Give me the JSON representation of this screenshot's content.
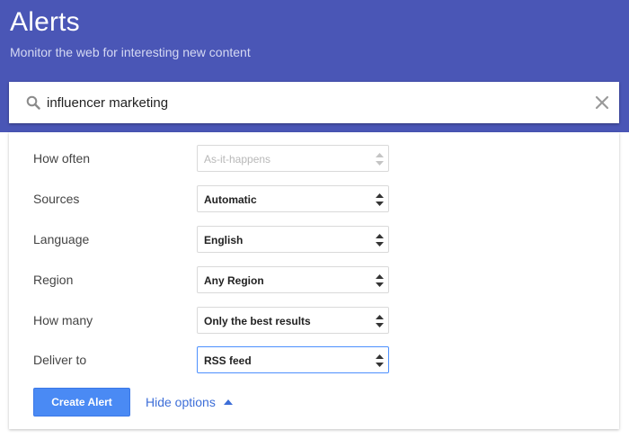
{
  "header": {
    "title": "Alerts",
    "subtitle": "Monitor the web for interesting new content",
    "background_color": "#4a56b6"
  },
  "search": {
    "query": "influencer marketing",
    "search_icon": "search-icon",
    "clear_icon": "close-icon"
  },
  "options": [
    {
      "key": "how-often",
      "label": "How often",
      "value": "As-it-happens",
      "state": "disabled"
    },
    {
      "key": "sources",
      "label": "Sources",
      "value": "Automatic",
      "state": "normal"
    },
    {
      "key": "language",
      "label": "Language",
      "value": "English",
      "state": "normal"
    },
    {
      "key": "region",
      "label": "Region",
      "value": "Any Region",
      "state": "normal"
    },
    {
      "key": "how-many",
      "label": "How many",
      "value": "Only the best results",
      "state": "normal"
    },
    {
      "key": "deliver-to",
      "label": "Deliver to",
      "value": "RSS feed",
      "state": "focused"
    }
  ],
  "actions": {
    "create_label": "Create Alert",
    "hide_options_label": "Hide options",
    "primary_color": "#4a8af4",
    "link_color": "#3d6ed8"
  }
}
